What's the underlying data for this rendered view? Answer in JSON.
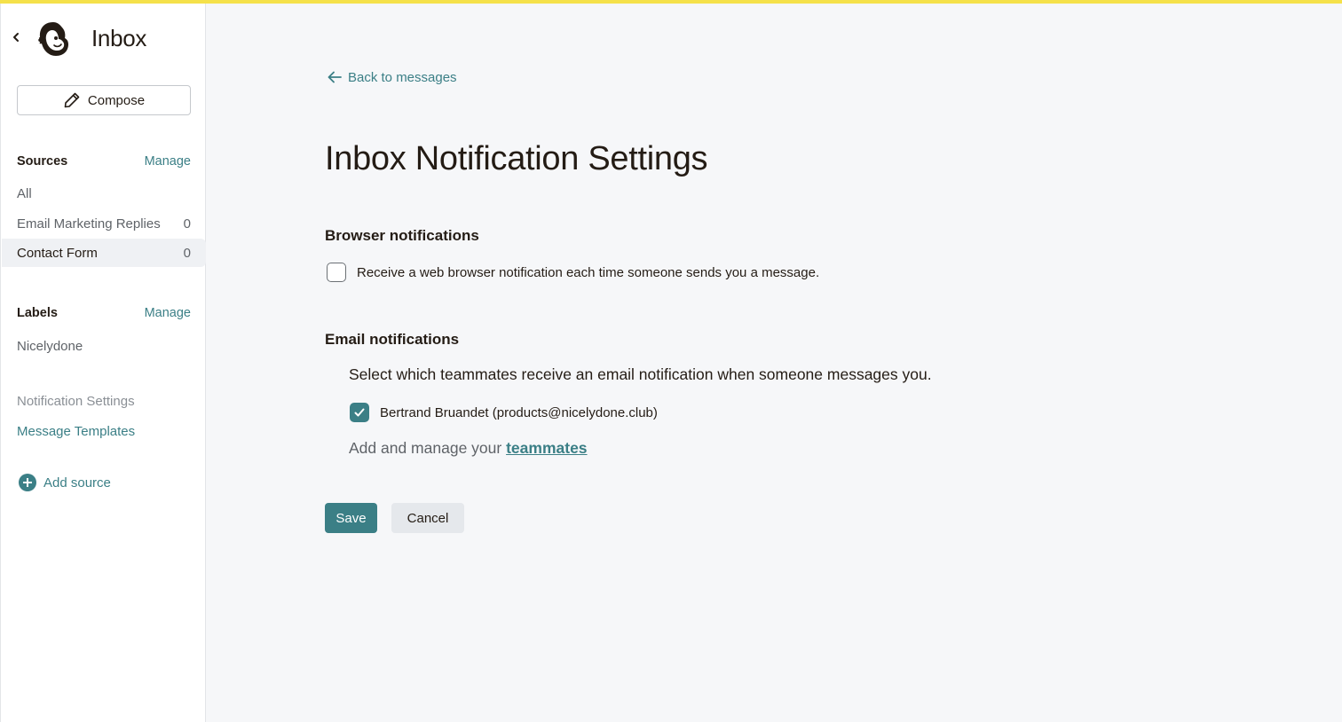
{
  "colors": {
    "accent": "#3b7f86",
    "top_bar": "#f5e14a",
    "background": "#f6f7f9"
  },
  "sidebar": {
    "back_icon": "chevron-left-icon",
    "logo_icon": "mailchimp-freddie-logo",
    "title": "Inbox",
    "compose_label": "Compose",
    "compose_icon": "pencil-icon",
    "sources": {
      "heading": "Sources",
      "manage_label": "Manage",
      "items": [
        {
          "label": "All",
          "count": ""
        },
        {
          "label": "Email Marketing Replies",
          "count": "0"
        },
        {
          "label": "Contact Form",
          "count": "0",
          "active": true
        }
      ]
    },
    "labels": {
      "heading": "Labels",
      "manage_label": "Manage",
      "items": [
        {
          "label": "Nicelydone"
        }
      ]
    },
    "notification_settings_label": "Notification Settings",
    "message_templates_label": "Message Templates",
    "add_source_label": "Add source",
    "add_source_icon": "plus-circle-icon"
  },
  "main": {
    "back_label": "Back to messages",
    "back_icon": "arrow-left-icon",
    "title": "Inbox Notification Settings",
    "browser": {
      "heading": "Browser notifications",
      "checkbox_label": "Receive a web browser notification each time someone sends you a message.",
      "checked": false
    },
    "email": {
      "heading": "Email notifications",
      "description": "Select which teammates receive an email notification when someone messages you.",
      "teammate_label": "Bertrand Bruandet (products@nicelydone.club)",
      "teammate_checked": true,
      "manage_prefix": "Add and manage your",
      "manage_link": "teammates"
    },
    "save_label": "Save",
    "cancel_label": "Cancel"
  }
}
